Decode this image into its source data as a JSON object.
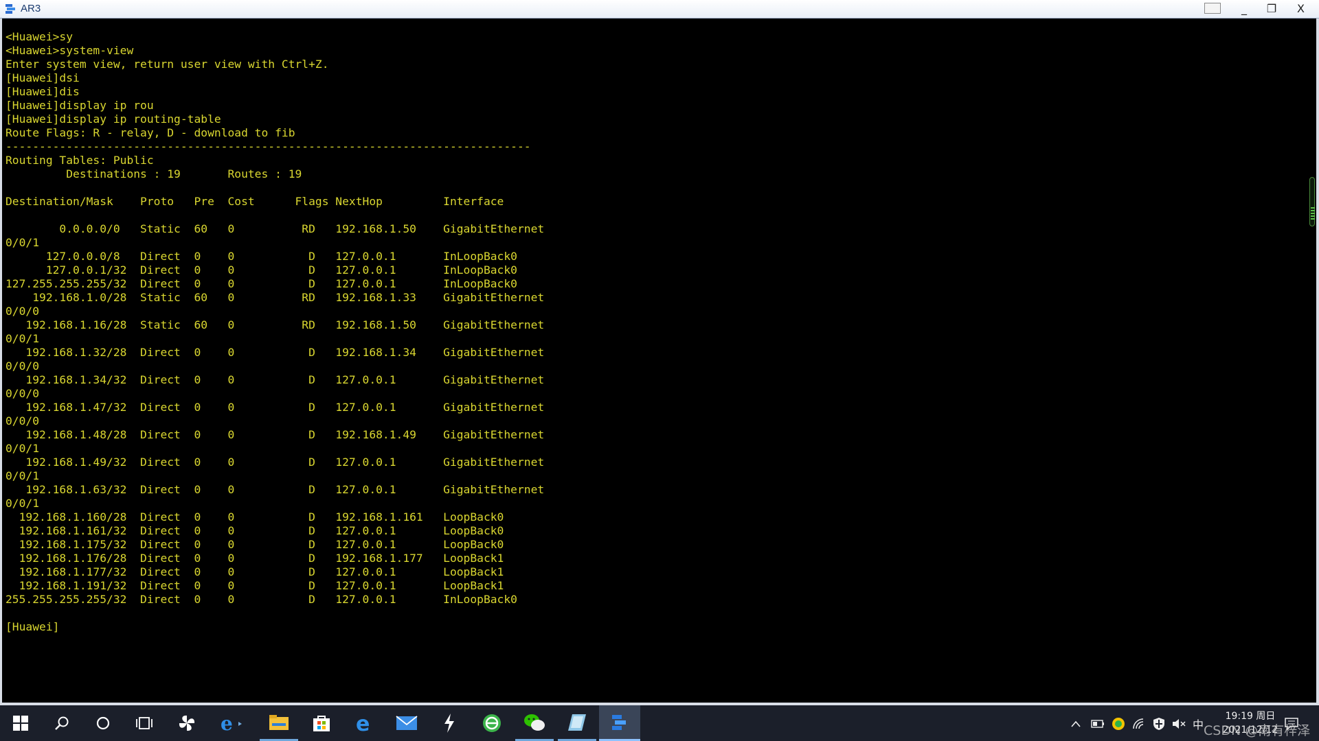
{
  "window": {
    "title": "AR3",
    "minimize_glyph": "_",
    "maximize_glyph": "❐",
    "close_glyph": "X"
  },
  "terminal": {
    "lines": [
      "<Huawei>sy",
      "<Huawei>system-view",
      "Enter system view, return user view with Ctrl+Z.",
      "[Huawei]dsi",
      "[Huawei]dis",
      "[Huawei]display ip rou",
      "[Huawei]display ip routing-table",
      "Route Flags: R - relay, D - download to fib",
      "------------------------------------------------------------------------------",
      "Routing Tables: Public",
      "         Destinations : 19       Routes : 19",
      "",
      "Destination/Mask    Proto   Pre  Cost      Flags NextHop         Interface",
      "",
      "        0.0.0.0/0   Static  60   0          RD   192.168.1.50    GigabitEthernet",
      "0/0/1",
      "      127.0.0.0/8   Direct  0    0           D   127.0.0.1       InLoopBack0",
      "      127.0.0.1/32  Direct  0    0           D   127.0.0.1       InLoopBack0",
      "127.255.255.255/32  Direct  0    0           D   127.0.0.1       InLoopBack0",
      "    192.168.1.0/28  Static  60   0          RD   192.168.1.33    GigabitEthernet",
      "0/0/0",
      "   192.168.1.16/28  Static  60   0          RD   192.168.1.50    GigabitEthernet",
      "0/0/1",
      "   192.168.1.32/28  Direct  0    0           D   192.168.1.34    GigabitEthernet",
      "0/0/0",
      "   192.168.1.34/32  Direct  0    0           D   127.0.0.1       GigabitEthernet",
      "0/0/0",
      "   192.168.1.47/32  Direct  0    0           D   127.0.0.1       GigabitEthernet",
      "0/0/0",
      "   192.168.1.48/28  Direct  0    0           D   192.168.1.49    GigabitEthernet",
      "0/0/1",
      "   192.168.1.49/32  Direct  0    0           D   127.0.0.1       GigabitEthernet",
      "0/0/1",
      "   192.168.1.63/32  Direct  0    0           D   127.0.0.1       GigabitEthernet",
      "0/0/1",
      "  192.168.1.160/28  Direct  0    0           D   192.168.1.161   LoopBack0",
      "  192.168.1.161/32  Direct  0    0           D   127.0.0.1       LoopBack0",
      "  192.168.1.175/32  Direct  0    0           D   127.0.0.1       LoopBack0",
      "  192.168.1.176/28  Direct  0    0           D   192.168.1.177   LoopBack1",
      "  192.168.1.177/32  Direct  0    0           D   127.0.0.1       LoopBack1",
      "  192.168.1.191/32  Direct  0    0           D   127.0.0.1       LoopBack1",
      "255.255.255.255/32  Direct  0    0           D   127.0.0.1       InLoopBack0",
      "",
      "[Huawei]"
    ]
  },
  "taskbar": {
    "icons": [
      {
        "name": "start-icon"
      },
      {
        "name": "search-icon"
      },
      {
        "name": "cortana-icon"
      },
      {
        "name": "task-view-icon"
      },
      {
        "name": "pinwheel-app-icon"
      },
      {
        "name": "internet-explorer-icon"
      },
      {
        "name": "file-explorer-icon"
      },
      {
        "name": "store-icon"
      },
      {
        "name": "edge-icon"
      },
      {
        "name": "mail-icon"
      },
      {
        "name": "lightning-app-icon"
      },
      {
        "name": "green-browser-icon"
      },
      {
        "name": "wechat-icon"
      },
      {
        "name": "virtualbox-icon"
      },
      {
        "name": "ensp-icon"
      }
    ],
    "tray": {
      "ime": "中",
      "time": "19:19 周日",
      "date": "2021/12/12"
    }
  },
  "watermark": "CSDN @南有梓泽"
}
